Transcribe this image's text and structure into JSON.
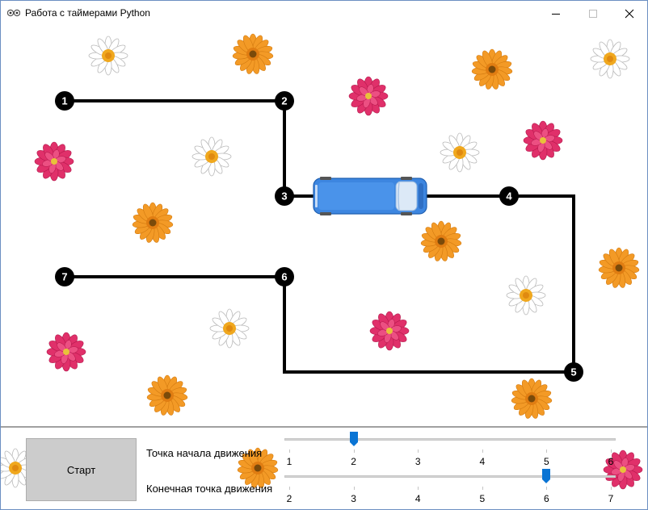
{
  "window": {
    "title": "Работа с таймерами Python",
    "minimize_icon": "minimize-icon",
    "maximize_icon": "maximize-icon",
    "close_icon": "close-icon"
  },
  "route": {
    "points": [
      "1",
      "2",
      "3",
      "4",
      "5",
      "6",
      "7"
    ]
  },
  "controls": {
    "start_label": "Старт",
    "start_slider_label": "Точка начала движения",
    "end_slider_label": "Конечная точка движения",
    "start_slider": {
      "ticks": [
        "1",
        "2",
        "3",
        "4",
        "5",
        "6"
      ],
      "value": 2
    },
    "end_slider": {
      "ticks": [
        "2",
        "3",
        "4",
        "5",
        "6",
        "7"
      ],
      "value": 6
    }
  },
  "colors": {
    "route_line": "#000000",
    "bus": "#3d86e0",
    "slider_thumb": "#0a74d4",
    "start_button": "#cccccc"
  }
}
